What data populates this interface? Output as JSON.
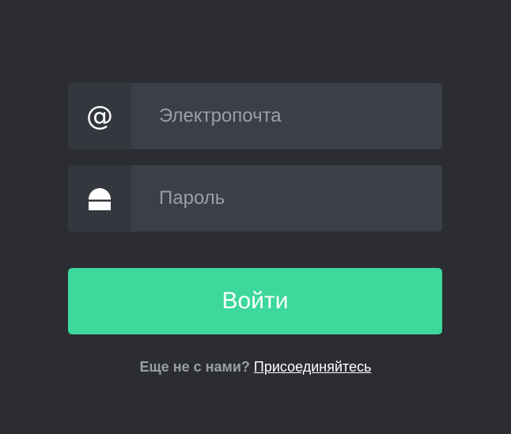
{
  "login": {
    "email": {
      "icon": "at-sign-icon",
      "icon_glyph": "@",
      "placeholder": "Электропочта",
      "value": ""
    },
    "password": {
      "icon": "lock-icon",
      "placeholder": "Пароль",
      "value": ""
    },
    "submit_label": "Войти",
    "signup_prompt": "Еще не с нами?",
    "signup_link": "Присоединяйтесь"
  },
  "colors": {
    "background": "#2b2d33",
    "field": "#3b3f47",
    "icon_box": "#34373e",
    "accent": "#3dd89b",
    "muted_text": "#9a9ea6"
  }
}
